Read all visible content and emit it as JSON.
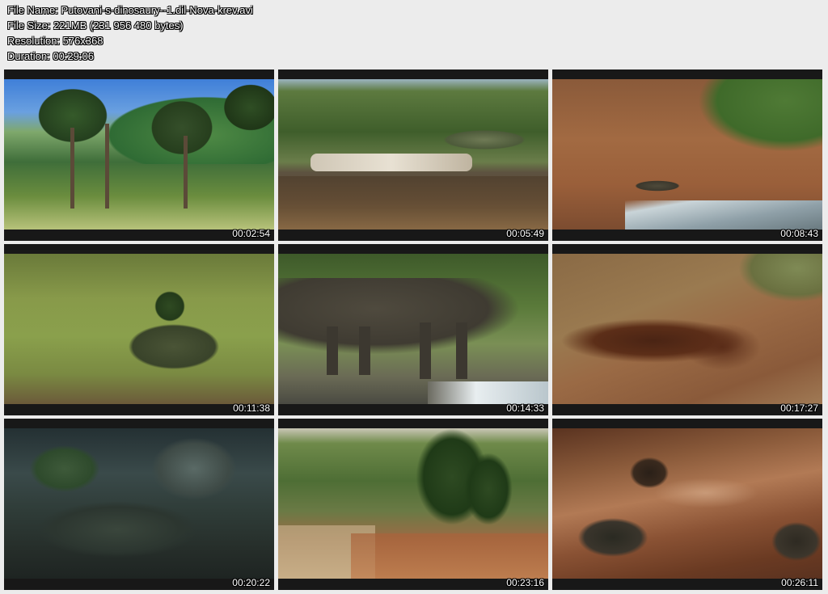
{
  "info": {
    "file_name": "File Name: Putovani-s-dinosaury--1.dil-Nova-krev.avi",
    "file_size": "File Size: 221MB (231 956 480 bytes)",
    "resolution": "Resolution: 576x368",
    "duration": "Duration: 00:29:06"
  },
  "thumbnails": [
    {
      "timestamp": "00:02:54",
      "scene": "araucaria-forest-hills"
    },
    {
      "timestamp": "00:05:49",
      "scene": "river-driftwood-dinosaur"
    },
    {
      "timestamp": "00:08:43",
      "scene": "red-earth-bank-lizard"
    },
    {
      "timestamp": "00:11:38",
      "scene": "grassland-dinosaur"
    },
    {
      "timestamp": "00:14:33",
      "scene": "large-reptile-drinking"
    },
    {
      "timestamp": "00:17:27",
      "scene": "eroded-red-soil"
    },
    {
      "timestamp": "00:20:22",
      "scene": "dark-forest-floor"
    },
    {
      "timestamp": "00:23:16",
      "scene": "forest-clearing-red-dirt"
    },
    {
      "timestamp": "00:26:11",
      "scene": "muddy-water-rocks"
    }
  ]
}
